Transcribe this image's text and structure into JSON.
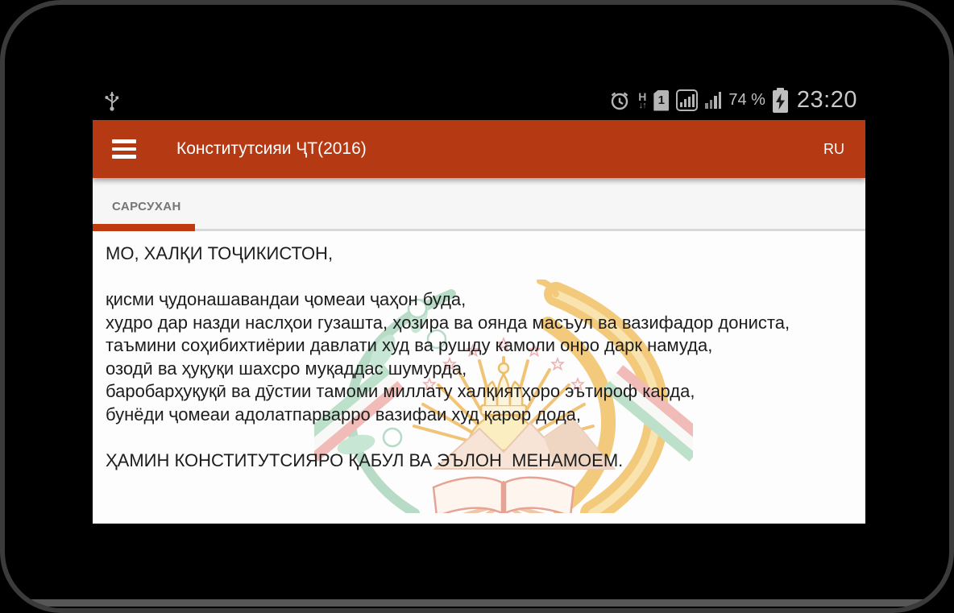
{
  "status_bar": {
    "time": "23:20",
    "battery_percent": "74 %",
    "network_mode": "H",
    "network_arrows": "↓↑",
    "sim_number": "1",
    "icons": [
      "usb",
      "alarm",
      "hspa-arrows",
      "sim-card",
      "signal-strength-boxed",
      "signal-strength",
      "battery-charging"
    ]
  },
  "app_bar": {
    "title": "Конститутсияи ҶТ(2016)",
    "language_label": "RU",
    "menu_icon": "hamburger-menu"
  },
  "tab_bar": {
    "tabs": [
      {
        "label": "САРСУХАН",
        "active": true
      }
    ]
  },
  "content": {
    "opening": "МО, ХАЛҚИ ТОҶИКИСТОН,",
    "lines": [
      "қисми ҷудонашавандаи ҷомеаи ҷаҳон буда,",
      "худро дар назди наслҳои гузашта, ҳозира ва оянда масъул ва вазифадор дониста,",
      "таъмини соҳибихтиёрии давлати худ ва рушду камоли онро дарк намуда,",
      "озодӣ ва ҳуқуқи шахсро муқаддас шумурда,",
      "баробарҳуқуқӣ ва дӯстии тамоми миллату халқиятҳоро эътироф карда,",
      "бунёди ҷомеаи адолатпарварро вазифаи худ қарор дода,"
    ],
    "closing": "ҲАМИН КОНСТИТУТСИЯРО ҚАБУЛ ВА ЭЪЛОН  МЕНАМОЕМ.",
    "watermark": "tajikistan-coat-of-arms"
  },
  "colors": {
    "app_bar": "#b53a14",
    "tab_underline": "#bf3a0e",
    "tab_text": "#757575",
    "body_text": "#1d1d1d",
    "status_icons": "#bdbdbd"
  }
}
